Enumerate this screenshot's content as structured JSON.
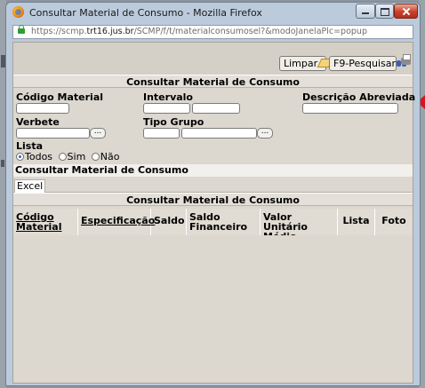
{
  "window": {
    "title": "Consultar Material de Consumo - Mozilla Firefox",
    "url_prefix": "https://scmp.",
    "url_domain": "trt16.jus.br",
    "url_path": "/SCMP/f/t/materialconsumosel?&modoJanelaPlc=popup"
  },
  "toolbar": {
    "limpar_label": "Limpar",
    "pesquisar_label": "F9-Pesquisar"
  },
  "search_form": {
    "title": "Consultar Material de Consumo",
    "codigo_label": "Código Material",
    "intervalo_label": "Intervalo",
    "descricao_label": "Descrição Abreviada",
    "verbete_label": "Verbete",
    "tipo_grupo_label": "Tipo Grupo",
    "lista_label": "Lista",
    "lista_options": [
      "Todos",
      "Sim",
      "Não"
    ],
    "lista_selected": "Todos",
    "lookup_button": "..."
  },
  "results": {
    "section_label": "Consultar Material de Consumo",
    "tab_excel": "Excel",
    "table_title": "Consultar Material de Consumo",
    "columns": [
      {
        "label": "Código Material",
        "sortable": true
      },
      {
        "label": "Especificação",
        "sortable": true
      },
      {
        "label": "Saldo",
        "sortable": false
      },
      {
        "label": "Saldo Financeiro",
        "sortable": false
      },
      {
        "label": "Valor Unitário Médio",
        "sortable": false
      },
      {
        "label": "Lista",
        "sortable": false
      },
      {
        "label": "Foto",
        "sortable": false
      }
    ]
  },
  "colors": {
    "window_frame": "#bccbdc",
    "content_bg": "#dcd7cf",
    "close_button": "#c8412a",
    "radio_accent": "#2c66c8"
  }
}
